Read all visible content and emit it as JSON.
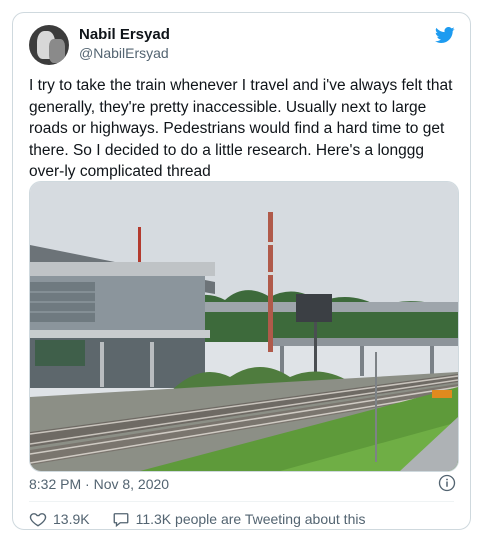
{
  "author": {
    "name": "Nabil Ersyad",
    "handle": "@NabilErsyad"
  },
  "tweet": {
    "text": "I try to take the train whenever I travel and i've always felt that generally, they're pretty inaccessible. Usually next to large roads or highways. Pedestrians would find a hard time to get there. So I decided to do a little research. Here's a longgg over-ly complicated thread",
    "timestamp": "8:32 PM · Nov 8, 2020"
  },
  "stats": {
    "likes": "13.9K",
    "tweeting": "11.3K people are Tweeting about this"
  },
  "icons": {
    "brand": "twitter-bird-icon",
    "like": "heart-icon",
    "comment": "speech-bubble-icon",
    "info": "info-icon"
  },
  "colors": {
    "brand": "#1d9bf0",
    "muted": "#536471",
    "text": "#0f1419",
    "border": "#cfd9de"
  }
}
